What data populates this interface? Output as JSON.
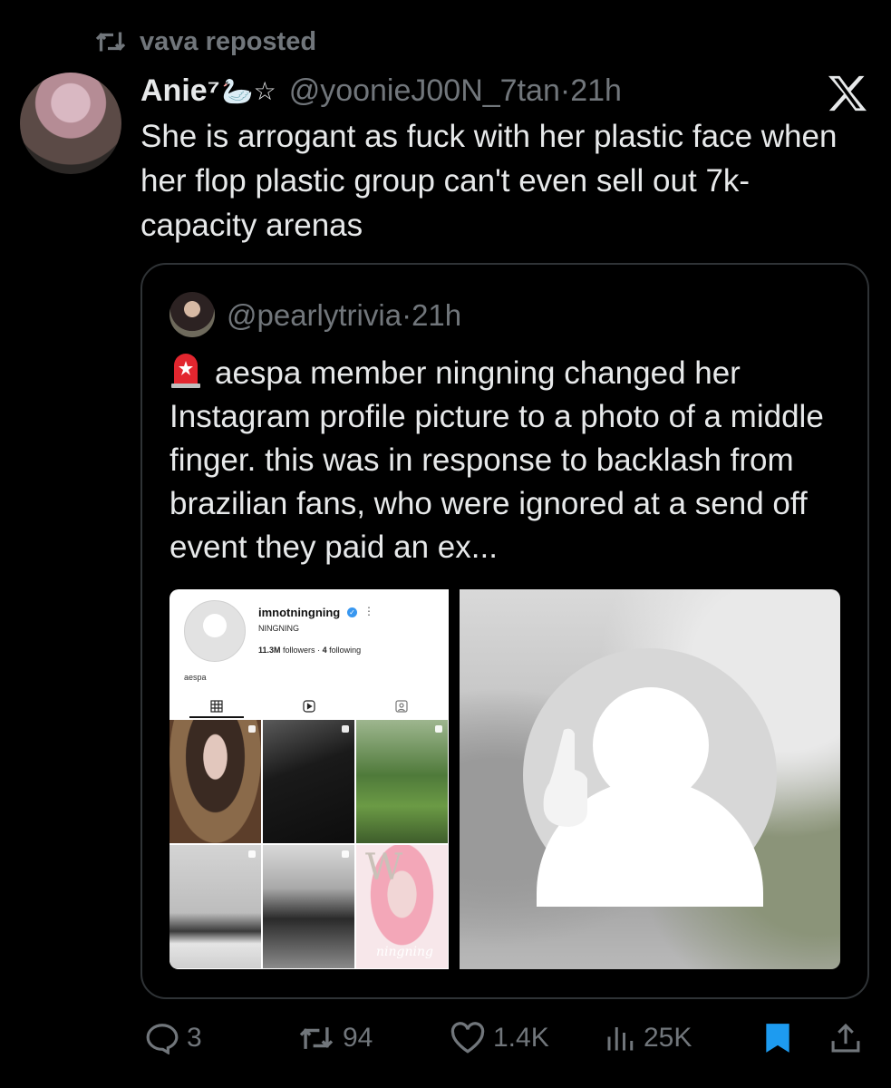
{
  "repost": {
    "icon": "repost-icon",
    "label": "vava reposted"
  },
  "tweet": {
    "author_name": "Anie⁷",
    "author_decoration": "🦢☆",
    "handle": "@yoonieJ00N_7tan",
    "separator": "·",
    "time": "21h",
    "text": "She is arrogant as fuck with her plastic face when her flop plastic group can't even sell out 7k-capacity arenas"
  },
  "quote": {
    "handle": "@pearlytrivia",
    "separator": "·",
    "time": "21h",
    "emoji_icon": "siren-icon",
    "text": "aespa member ningning changed her Instagram profile picture to a photo of a middle finger. this was in response to backlash from brazilian fans, who were ignored at a send off event they paid an ex..."
  },
  "instagram": {
    "username": "imnotningning",
    "verified_icon": "✓",
    "more": "⋮",
    "display_name": "NINGNING",
    "followers_count": "11.3M",
    "followers_label": "followers",
    "stats_separator": "·",
    "following_count": "4",
    "following_label": "following",
    "bio": "aespa",
    "watermark": "W",
    "signature": "ningning"
  },
  "actions": {
    "replies": "3",
    "reposts": "94",
    "likes": "1.4K",
    "views": "25K"
  },
  "colors": {
    "background": "#000000",
    "text": "#e7e9ea",
    "muted": "#71767b",
    "border": "#2f3336",
    "bookmark_active": "#1d9bf0"
  }
}
